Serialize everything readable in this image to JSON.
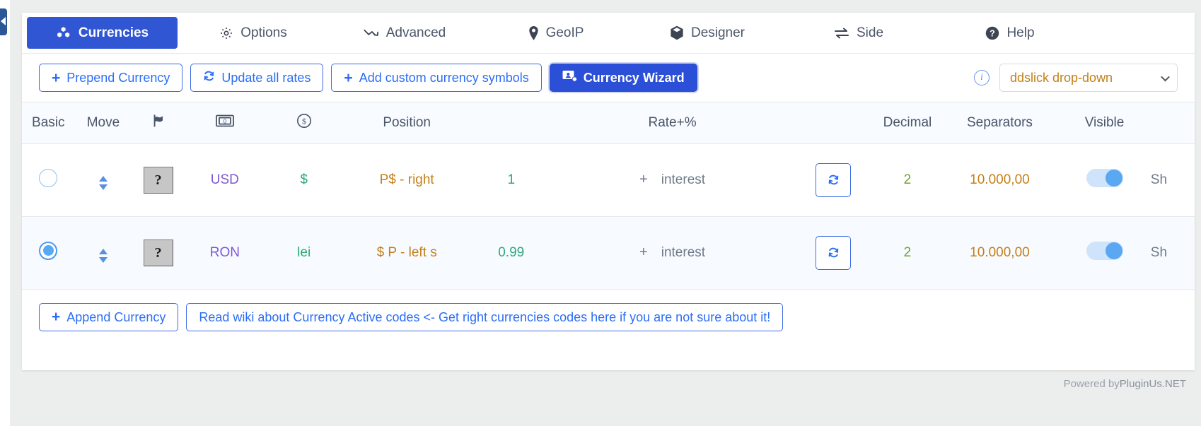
{
  "tabs": [
    {
      "label": "Currencies",
      "icon": "cubes-icon",
      "active": true
    },
    {
      "label": "Options",
      "icon": "gear-icon",
      "active": false
    },
    {
      "label": "Advanced",
      "icon": "chart-line-down-icon",
      "active": false
    },
    {
      "label": "GeoIP",
      "icon": "map-pin-icon",
      "active": false
    },
    {
      "label": "Designer",
      "icon": "cube-icon",
      "active": false
    },
    {
      "label": "Side",
      "icon": "exchange-arrows-icon",
      "active": false
    },
    {
      "label": "Help",
      "icon": "question-circle-icon",
      "active": false
    }
  ],
  "toolbar": {
    "prepend_currency": "Prepend Currency",
    "update_all_rates": "Update all rates",
    "add_custom_symbols": "Add custom currency symbols",
    "currency_wizard": "Currency Wizard",
    "plus": "+",
    "info_icon": "i",
    "dropdown_value": "ddslick drop-down"
  },
  "table": {
    "headers": {
      "basic": "Basic",
      "move": "Move",
      "flag": "",
      "money": "",
      "symbol": "",
      "position": "Position",
      "rate": "",
      "rate_pct": "Rate+%",
      "refresh": "",
      "decimal": "Decimal",
      "separators": "Separators",
      "visible": "Visible",
      "extra": ""
    },
    "header_icons": {
      "flag": "flag-icon",
      "money": "money-bill-icon",
      "symbol": "dollar-circle-icon"
    },
    "rows": [
      {
        "selected": false,
        "flag_alt": "?",
        "code": "USD",
        "symbol": "$",
        "position": "P$ - right",
        "rate": "1",
        "rate_op": "+",
        "rate_word": "interest",
        "decimal": "2",
        "separators": "10.000,00",
        "visible": true,
        "extra": "Sh"
      },
      {
        "selected": true,
        "flag_alt": "?",
        "code": "RON",
        "symbol": "lei",
        "position": "$ P - left s",
        "rate": "0.99",
        "rate_op": "+",
        "rate_word": "interest",
        "decimal": "2",
        "separators": "10.000,00",
        "visible": true,
        "extra": "Sh"
      }
    ]
  },
  "bottom": {
    "append_currency": "Append Currency",
    "plus": "+",
    "wiki_link": "Read wiki about Currency Active codes <- Get right currencies codes here if you are not sure about it!"
  },
  "footer": {
    "powered_prefix": "Powered by ",
    "powered_brand": "PluginUs.NET"
  },
  "colors": {
    "accent": "#2b4fd7",
    "link": "#2b6ef6",
    "gold": "#c47f17",
    "green": "#2fa87a",
    "purple": "#7e57d6"
  }
}
